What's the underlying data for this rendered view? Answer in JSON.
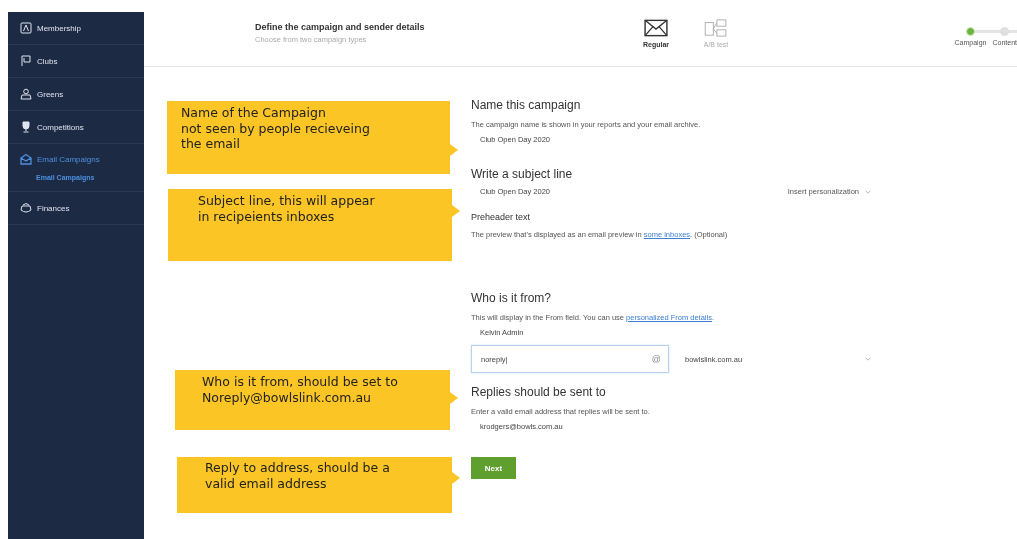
{
  "sidebar": {
    "items": [
      {
        "label": "Membership",
        "selected": false
      },
      {
        "label": "Clubs",
        "selected": false
      },
      {
        "label": "Greens",
        "selected": false
      },
      {
        "label": "Competitions",
        "selected": false
      },
      {
        "label": "Email Campaigns",
        "selected": true,
        "children": [
          {
            "label": "Email Campaigns",
            "selected": true
          }
        ]
      },
      {
        "label": "Finances",
        "selected": false
      }
    ]
  },
  "header": {
    "title": "Define the campaign and sender details",
    "subtitle": "Choose from two campaign types",
    "types": [
      {
        "label": "Regular",
        "selected": true
      },
      {
        "label": "A/B test",
        "selected": false
      }
    ],
    "steps": [
      {
        "label": "Campaign",
        "done": true
      },
      {
        "label": "Content",
        "done": false
      }
    ]
  },
  "form": {
    "name_section": {
      "heading": "Name this campaign",
      "description": "The campaign name is shown in your reports and your email archive.",
      "value": "Club Open Day 2020"
    },
    "subject_section": {
      "heading": "Write a subject line",
      "value": "Club Open Day 2020",
      "personalization": "Insert personalization"
    },
    "preheader_section": {
      "heading": "Preheader text",
      "description_before": "The preview that's displayed as an email preview in ",
      "link": "some inboxes",
      "description_after": ". (Optional)"
    },
    "from_section": {
      "heading": "Who is it from?",
      "description_before": "This will display in the From field. You can use ",
      "link": "personalized From details",
      "description_after": ".",
      "name_value": "Kelvin Admin",
      "email_value": "noreply|",
      "at_sign": "@",
      "domain": "bowlslink.com.au"
    },
    "reply_section": {
      "heading": "Replies should be sent to",
      "description": "Enter a valid email address that replies will be sent to.",
      "value": "krodgers@bowls.com.au"
    },
    "next_button": "Next"
  },
  "callouts": [
    {
      "text": "Name of the Campaign\nnot seen by people recieveing\nthe email"
    },
    {
      "text": "Subject line, this will appear\nin recipeients inboxes"
    },
    {
      "text": "Who is it from, should be set to\nNoreply@bowlslink.com.au"
    },
    {
      "text": "Reply to address, should be a\nvalid email address"
    }
  ]
}
